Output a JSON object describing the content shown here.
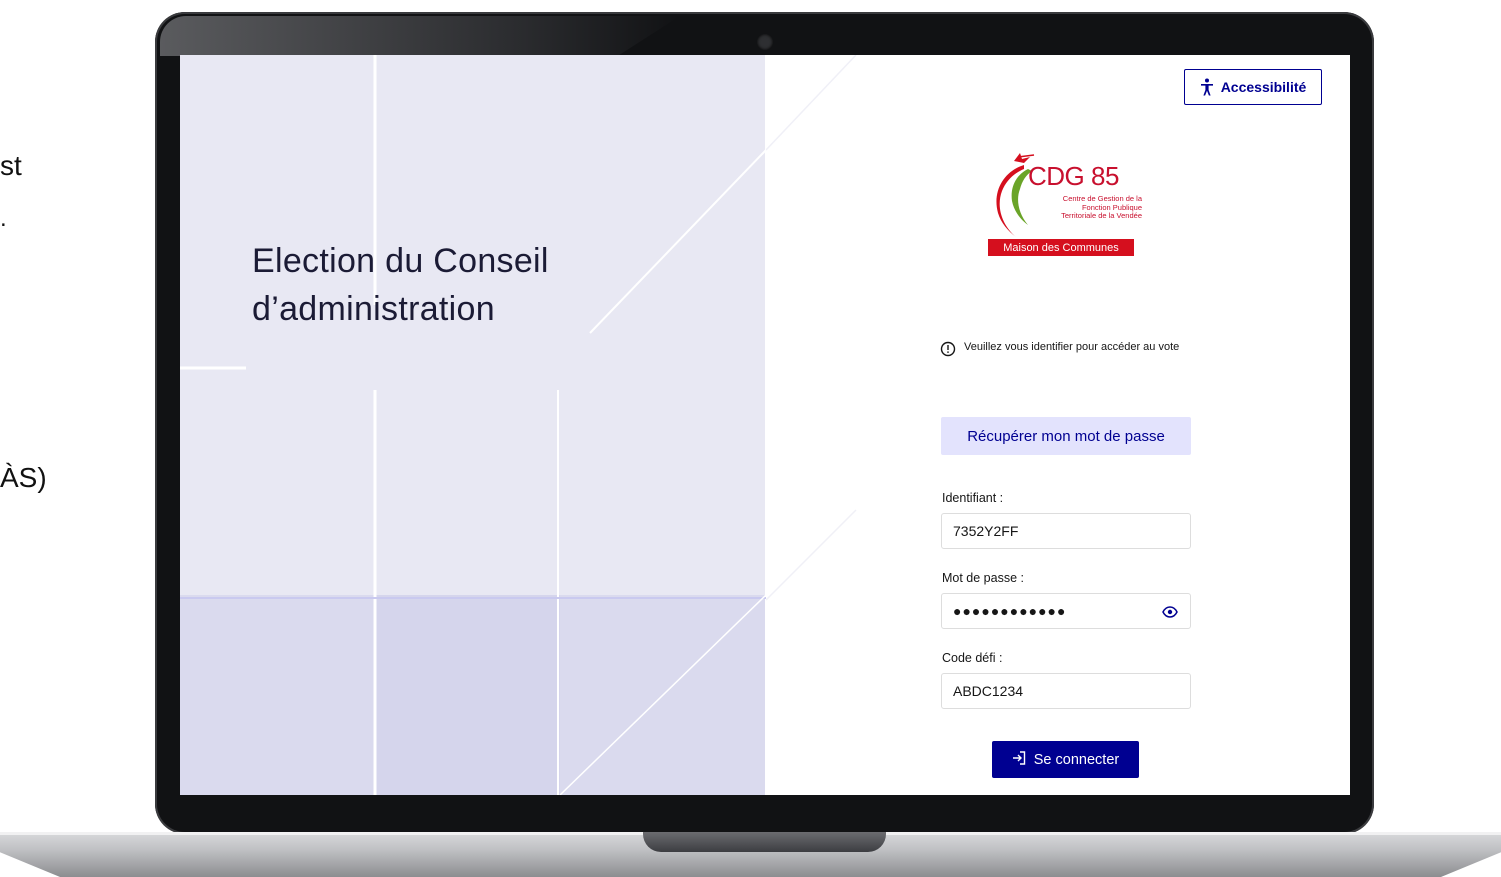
{
  "background_fragments": [
    "st",
    ".",
    "ÀS)"
  ],
  "left_panel": {
    "title_lines": [
      "Election du Conseil",
      "d’administration"
    ]
  },
  "header": {
    "accessibility_label": "Accessibilité",
    "accessibility_icon": "accessibility-person-icon"
  },
  "logo": {
    "name": "CDG 85",
    "subtitle_lines": [
      "Centre de Gestion de la",
      "Fonction Publique",
      "Territoriale de la Vendée"
    ],
    "band_text": "Maison des Communes"
  },
  "notice": {
    "icon": "info-circle-icon",
    "text": "Veuillez vous identifier pour accéder au vote"
  },
  "form": {
    "recover_label": "Récupérer mon mot de passe",
    "identifier_label": "Identifiant :",
    "identifier_value": "7352Y2FF",
    "password_label": "Mot de passe :",
    "password_value": "●●●●●●●●●●●●",
    "password_toggle_icon": "eye-icon",
    "code_label": "Code défi :",
    "code_value": "ABDC1234",
    "submit_label": "Se connecter",
    "submit_icon": "login-arrow-icon"
  },
  "colors": {
    "primary": "#000091",
    "primary_light": "#e3e3fd",
    "panel_bg": "#e8e8f3",
    "brand_red": "#d50f1e"
  }
}
